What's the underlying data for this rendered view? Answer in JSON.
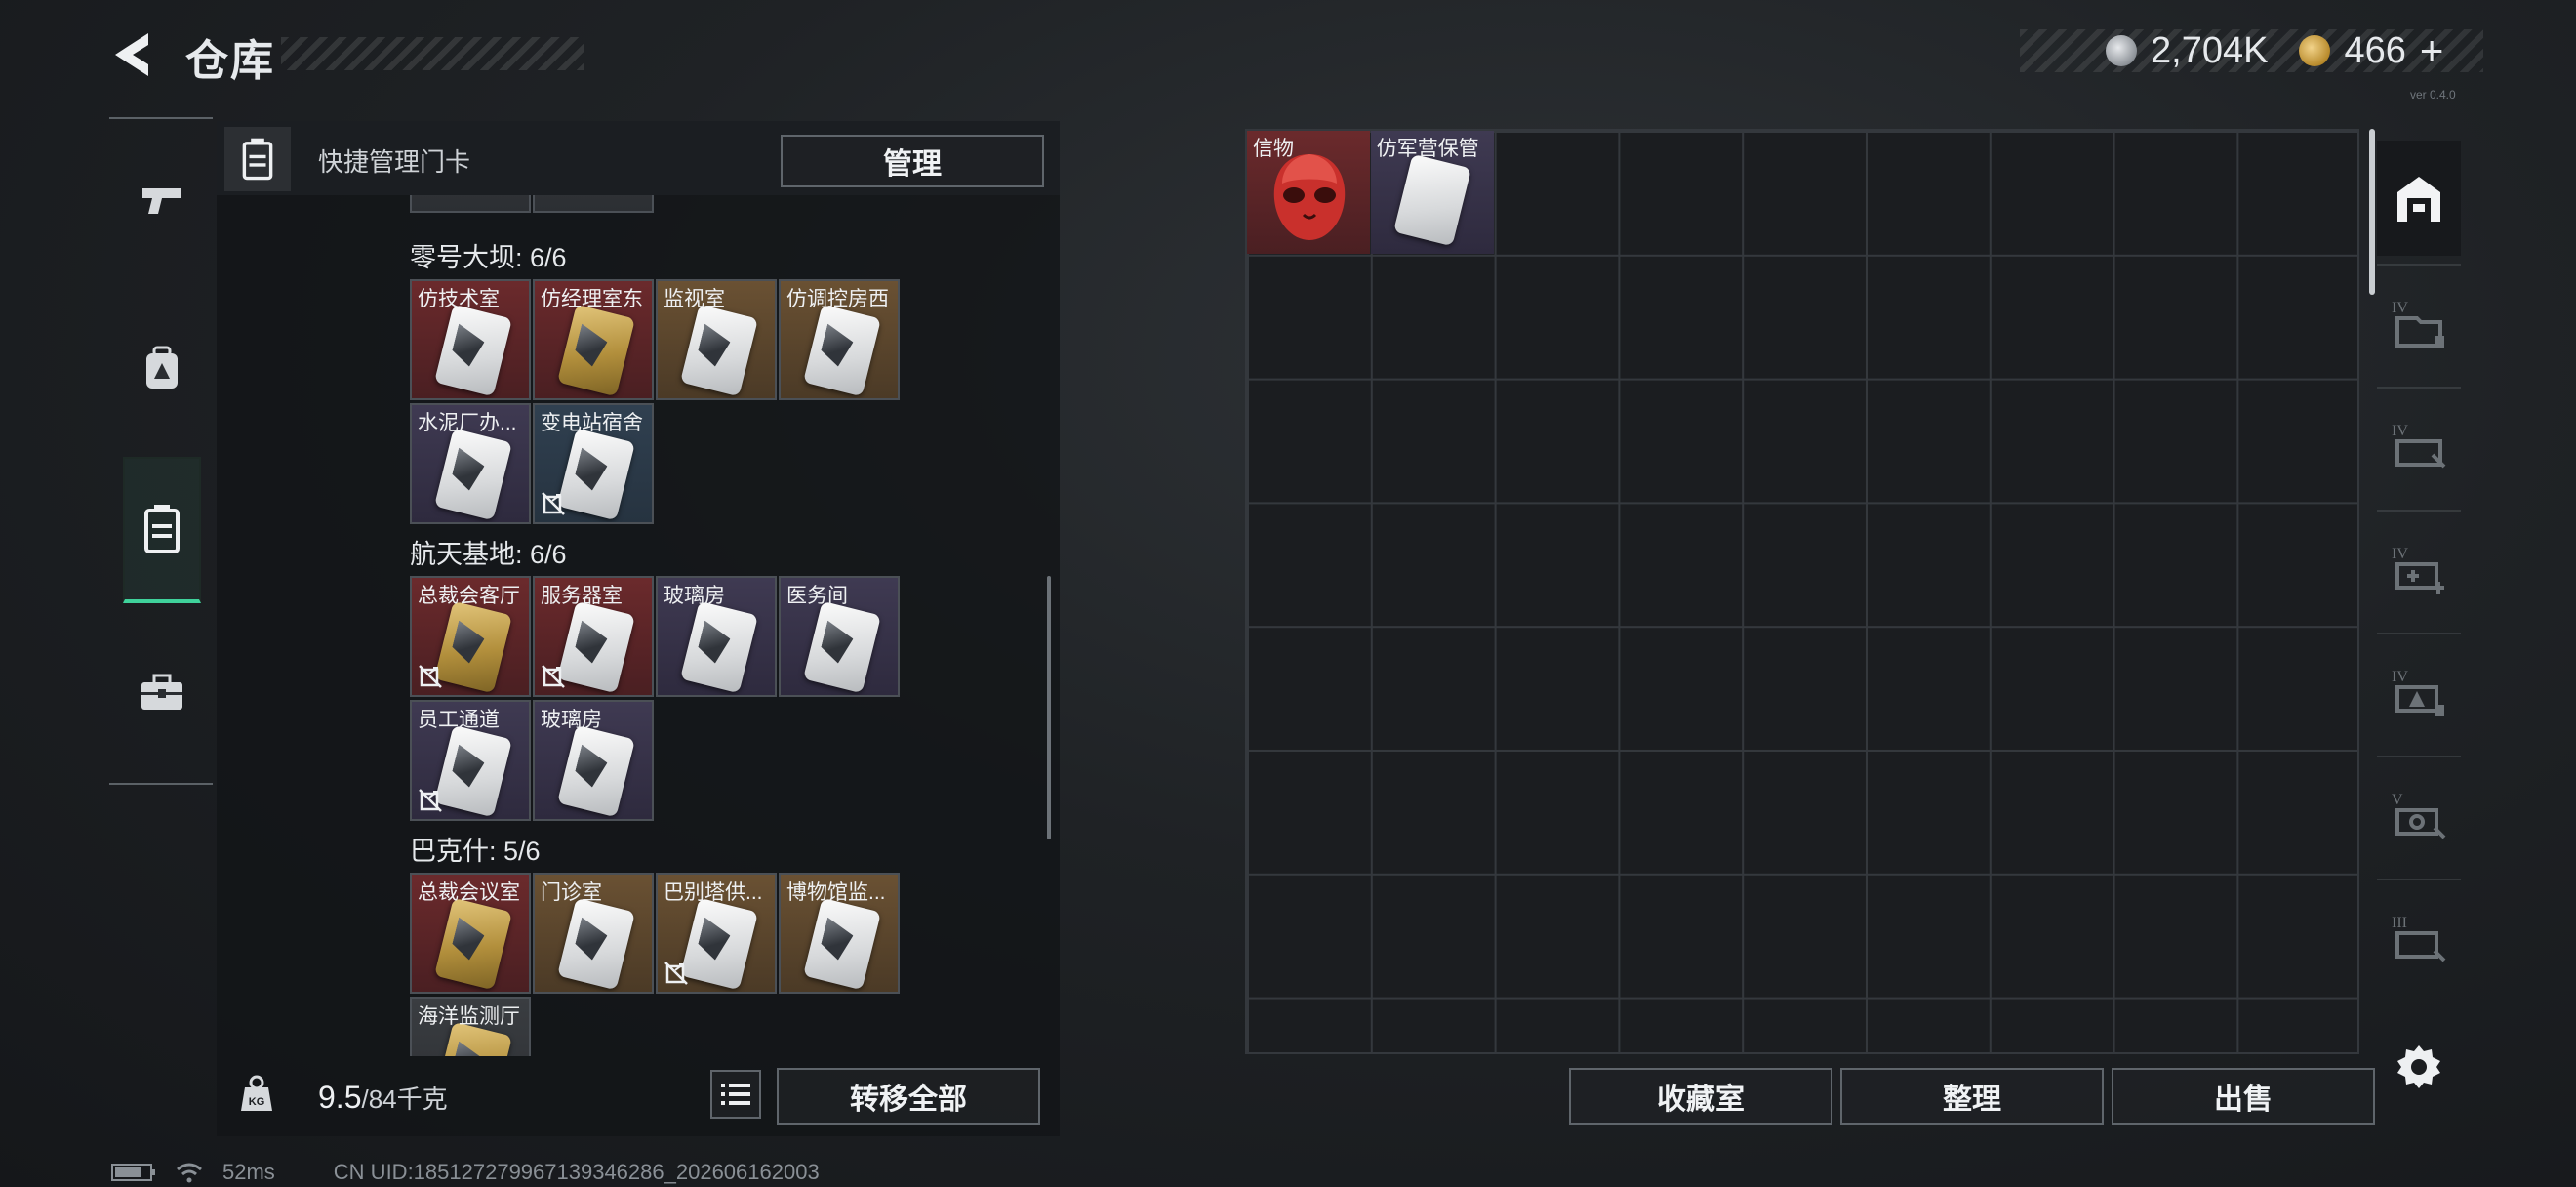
{
  "header": {
    "title": "仓库",
    "version": "ver 0.4.0"
  },
  "currency": {
    "silver": "2,704K",
    "gold": "466",
    "gold_add": "+"
  },
  "nav": {
    "items": [
      "weapon-icon",
      "armor-icon",
      "keycard-icon",
      "toolbox-icon"
    ],
    "active": 2
  },
  "quick_manage": {
    "label": "快捷管理门卡",
    "button": "管理"
  },
  "sections": [
    {
      "title": "零号大坝: 6/6",
      "cards": [
        {
          "name": "仿技术室",
          "rarity": "red",
          "gold": false,
          "no_extract": false
        },
        {
          "name": "仿经理室东",
          "rarity": "red",
          "gold": true,
          "no_extract": false
        },
        {
          "name": "监视室",
          "rarity": "gold",
          "gold": false,
          "no_extract": false
        },
        {
          "name": "仿调控房西",
          "rarity": "gold",
          "gold": false,
          "no_extract": false
        },
        {
          "name": "水泥厂办...",
          "rarity": "purple",
          "gold": false,
          "no_extract": false
        },
        {
          "name": "变电站宿舍",
          "rarity": "blue",
          "gold": false,
          "no_extract": true
        }
      ]
    },
    {
      "title": "航天基地: 6/6",
      "cards": [
        {
          "name": "总裁会客厅",
          "rarity": "red",
          "gold": true,
          "no_extract": true
        },
        {
          "name": "服务器室",
          "rarity": "red",
          "gold": false,
          "no_extract": true
        },
        {
          "name": "玻璃房",
          "rarity": "purple",
          "gold": false,
          "no_extract": false
        },
        {
          "name": "医务间",
          "rarity": "purple",
          "gold": false,
          "no_extract": false
        },
        {
          "name": "员工通道",
          "rarity": "purple",
          "gold": false,
          "no_extract": true
        },
        {
          "name": "玻璃房",
          "rarity": "purple",
          "gold": false,
          "no_extract": false
        }
      ]
    },
    {
      "title": "巴克什: 5/6",
      "cards": [
        {
          "name": "总裁会议室",
          "rarity": "red",
          "gold": true,
          "no_extract": false
        },
        {
          "name": "门诊室",
          "rarity": "gold",
          "gold": false,
          "no_extract": false
        },
        {
          "name": "巴别塔供...",
          "rarity": "gold",
          "gold": false,
          "no_extract": true
        },
        {
          "name": "博物馆监...",
          "rarity": "gold",
          "gold": false,
          "no_extract": false
        },
        {
          "name": "海洋监测厅",
          "rarity": "grey",
          "gold": true,
          "no_extract": false
        }
      ]
    }
  ],
  "bottom_left": {
    "weight": "9.5",
    "weight_max": "/84千克",
    "transfer_all": "转移全部"
  },
  "storage_items": [
    {
      "name": "信物",
      "icon": "red-mask-icon",
      "rarity": "red"
    },
    {
      "name": "仿军营保管",
      "icon": "keycard-icon",
      "rarity": "purple"
    }
  ],
  "bottom_right": {
    "collection": "收藏室",
    "organize": "整理",
    "sell": "出售"
  },
  "right_sidebar": [
    "storage-home-icon",
    "container-iv-1-icon",
    "container-iv-2-icon",
    "container-iv-3-icon",
    "container-iv-4-icon",
    "container-v-icon",
    "container-iii-icon"
  ],
  "status": {
    "ping": "52ms",
    "uid": "CN UID:185127279967139346286_202606162003"
  },
  "colors": {
    "accent": "#3fd29b",
    "red_rarity": "#6b2a2c",
    "gold_rarity": "#6a5133",
    "purple_rarity": "#3f3a52",
    "blue_rarity": "#304050"
  }
}
